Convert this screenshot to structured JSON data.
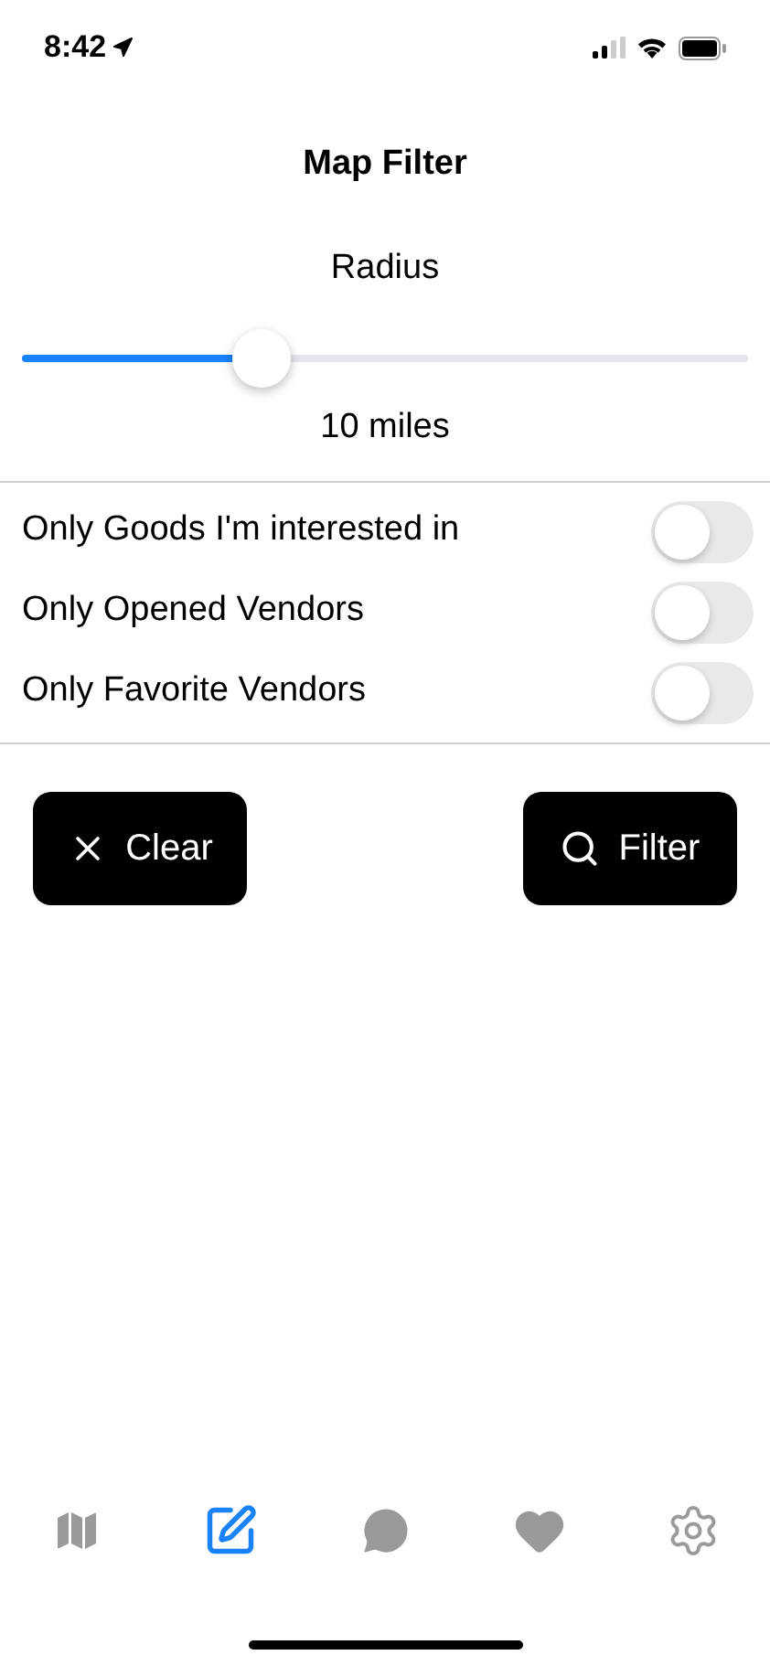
{
  "status_bar": {
    "time": "8:42"
  },
  "title": "Map Filter",
  "radius": {
    "label": "Radius",
    "level": 0.33,
    "reading": "10 miles"
  },
  "toggles": [
    {
      "label": "Only Goods I'm interested in",
      "on": false
    },
    {
      "label": "Only Opened Vendors",
      "on": false
    },
    {
      "label": "Only Favorite Vendors",
      "on": false
    }
  ],
  "buttons": [
    {
      "kind": "clear",
      "label": "Clear"
    },
    {
      "kind": "filter",
      "label": "Filter"
    }
  ],
  "tab_bar": [
    {
      "kind": "map",
      "selected": false
    },
    {
      "kind": "compose",
      "selected": true
    },
    {
      "kind": "chat",
      "selected": false
    },
    {
      "kind": "heart",
      "selected": false
    },
    {
      "kind": "settings",
      "selected": false
    }
  ]
}
